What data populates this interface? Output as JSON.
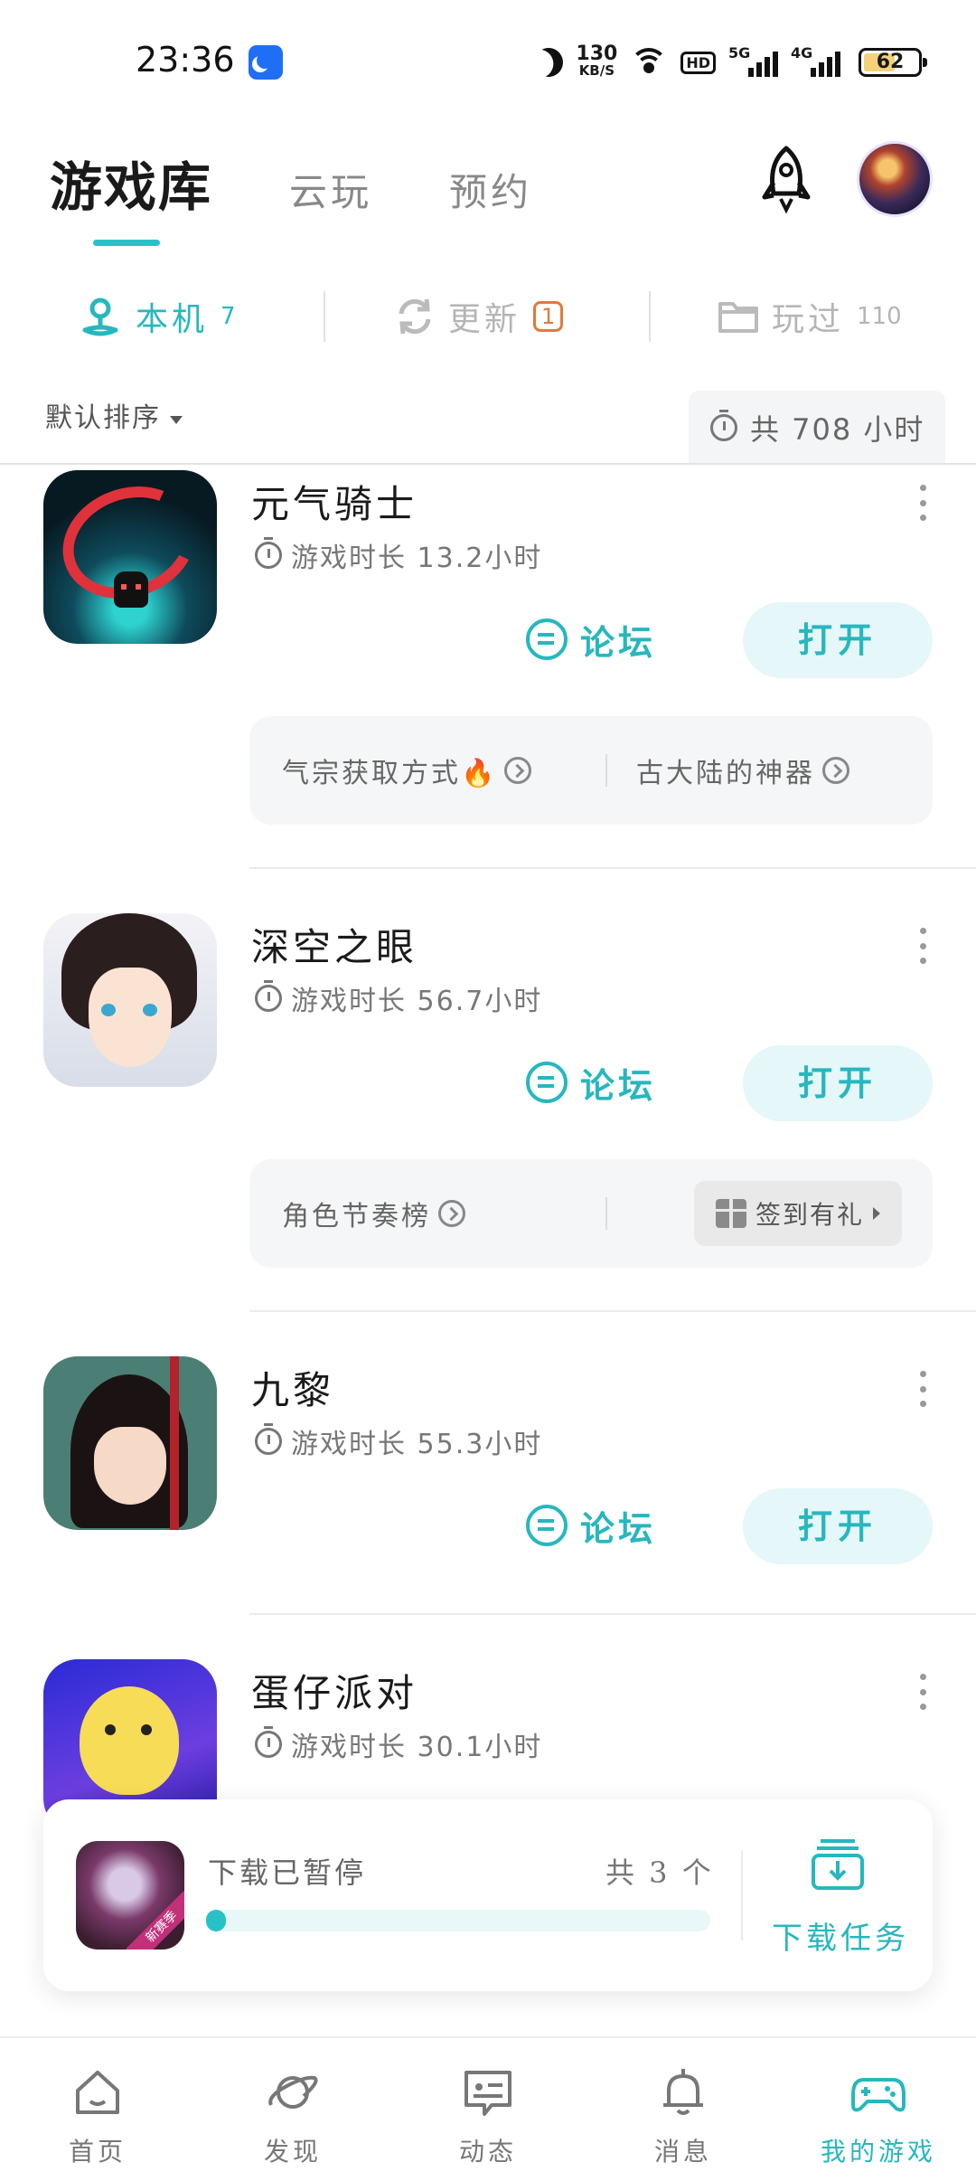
{
  "status_bar": {
    "time": "23:36",
    "net_speed_value": "130",
    "net_speed_unit": "KB/S",
    "hd_label": "HD",
    "signal1_label": "5G",
    "signal2_label": "4G",
    "battery": "62"
  },
  "header": {
    "tabs": [
      {
        "label": "游戏库",
        "active": true
      },
      {
        "label": "云玩",
        "active": false
      },
      {
        "label": "预约",
        "active": false
      }
    ]
  },
  "sub_tabs": [
    {
      "label": "本机",
      "count": "7",
      "active": true
    },
    {
      "label": "更新",
      "badge": "1",
      "active": false
    },
    {
      "label": "玩过",
      "count": "110",
      "active": false
    }
  ],
  "sort": {
    "label": "默认排序"
  },
  "total_time": {
    "label": "共 708 小时"
  },
  "games": [
    {
      "title": "元气骑士",
      "playtime": "游戏时长 13.2小时",
      "forum_label": "论坛",
      "open_label": "打开",
      "tips": [
        "气宗获取方式🔥",
        "古大陆的神器"
      ]
    },
    {
      "title": "深空之眼",
      "playtime": "游戏时长 56.7小时",
      "forum_label": "论坛",
      "open_label": "打开",
      "tips": [
        "角色节奏榜"
      ],
      "signin_label": "签到有礼"
    },
    {
      "title": "九黎",
      "playtime": "游戏时长 55.3小时",
      "forum_label": "论坛",
      "open_label": "打开"
    },
    {
      "title": "蛋仔派对",
      "playtime": "游戏时长 30.1小时"
    }
  ],
  "download": {
    "status": "下载已暂停",
    "count": "共 3 个",
    "progress": 0.04,
    "task_label": "下载任务",
    "thumb_tag": "新赛季"
  },
  "bottom_nav": [
    {
      "label": "首页",
      "icon": "home-icon",
      "active": false
    },
    {
      "label": "发现",
      "icon": "planet-icon",
      "active": false
    },
    {
      "label": "动态",
      "icon": "message-icon",
      "active": false
    },
    {
      "label": "消息",
      "icon": "bell-icon",
      "active": false
    },
    {
      "label": "我的游戏",
      "icon": "gamepad-icon",
      "active": true
    }
  ],
  "colors": {
    "accent": "#27b7be",
    "badge": "#e07a3a"
  }
}
